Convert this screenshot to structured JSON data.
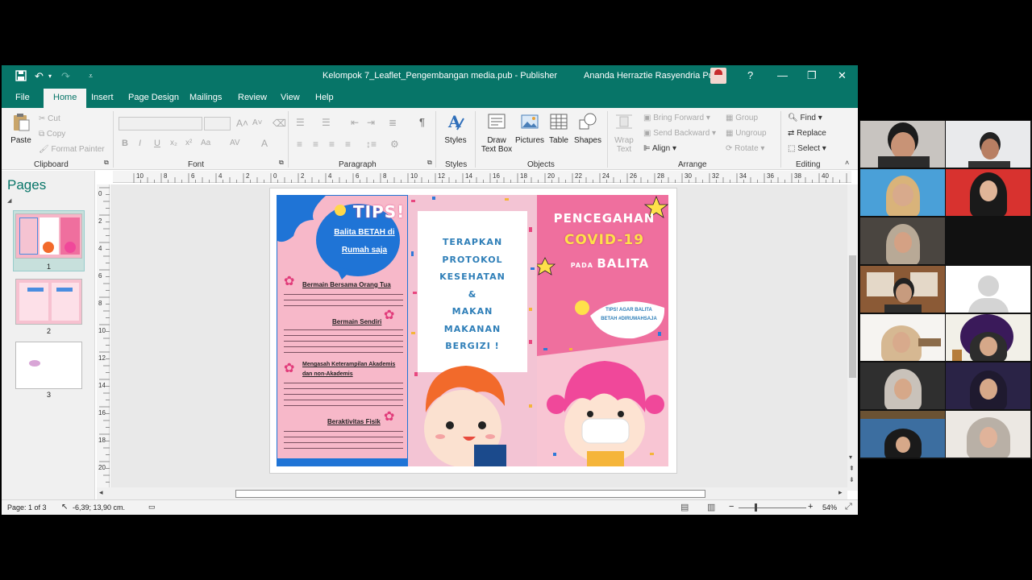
{
  "titlebar": {
    "title": "Kelompok 7_Leaflet_Pengembangan media.pub  -  Publisher",
    "user": "Ananda Herraztie Rasyendria Putri",
    "help": "?"
  },
  "tabs": [
    "File",
    "Home",
    "Insert",
    "Page Design",
    "Mailings",
    "Review",
    "View",
    "Help"
  ],
  "ribbon": {
    "clipboard": {
      "label": "Clipboard",
      "paste": "Paste",
      "cut": "Cut",
      "copy": "Copy",
      "format_painter": "Format Painter"
    },
    "font": {
      "label": "Font"
    },
    "paragraph": {
      "label": "Paragraph"
    },
    "styles": {
      "label": "Styles",
      "btn": "Styles"
    },
    "objects": {
      "label": "Objects",
      "draw_text_box_1": "Draw",
      "draw_text_box_2": "Text Box",
      "pictures": "Pictures",
      "table": "Table",
      "shapes": "Shapes"
    },
    "arrange": {
      "label": "Arrange",
      "wrap_1": "Wrap",
      "wrap_2": "Text",
      "bring_forward": "Bring Forward",
      "send_backward": "Send Backward",
      "align": "Align",
      "group": "Group",
      "ungroup": "Ungroup",
      "rotate": "Rotate"
    },
    "editing": {
      "label": "Editing",
      "find": "Find",
      "replace": "Replace",
      "select": "Select"
    }
  },
  "pages_panel": {
    "title": "Pages",
    "pages": [
      "1",
      "2",
      "3"
    ]
  },
  "ruler_h": [
    "10",
    "8",
    "6",
    "4",
    "2",
    "0",
    "2",
    "4",
    "6",
    "8",
    "10",
    "12",
    "14",
    "16",
    "18",
    "20",
    "22",
    "24",
    "26",
    "28",
    "30",
    "32",
    "34",
    "36",
    "38",
    "40",
    "42"
  ],
  "ruler_v": [
    "0",
    "2",
    "4",
    "6",
    "8",
    "10",
    "12",
    "14",
    "16",
    "18",
    "20"
  ],
  "leaflet": {
    "left": {
      "tips": "TIPS!",
      "bubble_1": "Balita BETAH di",
      "bubble_2": "Rumah saja",
      "h1": "Bermain Bersama Orang Tua",
      "h2": "Bermain Sendiri",
      "h3_1": "Mengasah Keterampilan Akademis",
      "h3_2": "dan non-Akademis",
      "h4": "Beraktivitas Fisik"
    },
    "middle": {
      "lines": [
        "TERAPKAN",
        "PROTOKOL",
        "KESEHATAN",
        "&",
        "MAKAN",
        "MAKANAN",
        "BERGIZI !"
      ]
    },
    "right": {
      "title_1": "PENCEGAHAN",
      "title_2": "COVID-19",
      "title_3a": "PADA",
      "title_3b": "BALITA",
      "tips_1": "TIPS! AGAR BALITA",
      "tips_2": "BETAH #DIRUMAHSAJA"
    }
  },
  "statusbar": {
    "page": "Page: 1 of 3",
    "position": "-6,39; 13,90 cm.",
    "zoom": "54%"
  },
  "colors": {
    "accent": "#077568",
    "pink": "#f7b6c8",
    "hotpink": "#ef5f94",
    "blue": "#1f74d6"
  }
}
